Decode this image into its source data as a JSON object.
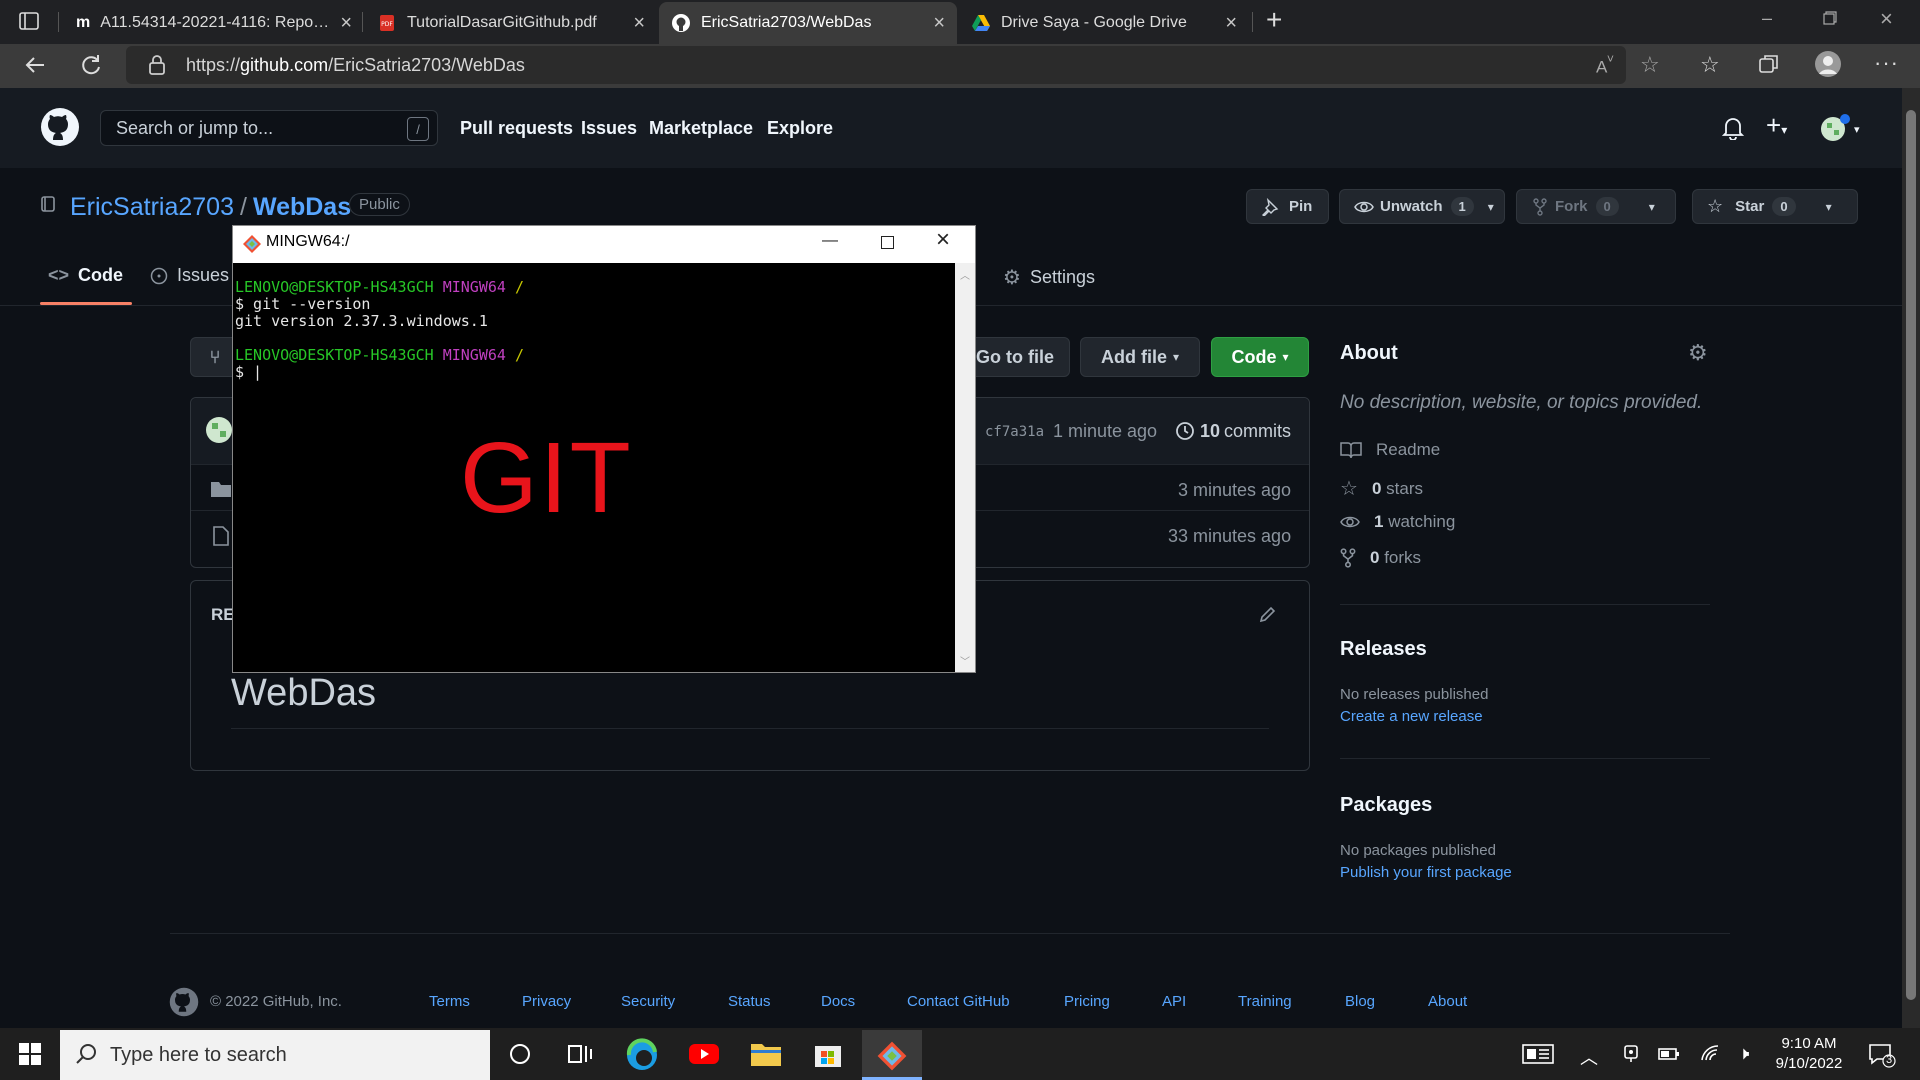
{
  "browser": {
    "tabs": [
      {
        "label": "A11.54314-20221-4116: Repositc"
      },
      {
        "label": "TutorialDasarGitGithub.pdf"
      },
      {
        "label": "EricSatria2703/WebDas"
      },
      {
        "label": "Drive Saya - Google Drive"
      }
    ],
    "url_prefix": "https://",
    "url_host": "github.com",
    "url_path": "/EricSatria2703/WebDas"
  },
  "github": {
    "search_placeholder": "Search or jump to...",
    "search_key": "/",
    "nav": [
      "Pull requests",
      "Issues",
      "Marketplace",
      "Explore"
    ]
  },
  "repo": {
    "owner": "EricSatria2703",
    "sep": "/",
    "name": "WebDas",
    "visibility": "Public",
    "pin_label": "Pin",
    "watch_label": "Unwatch",
    "watch_count": "1",
    "fork_label": "Fork",
    "fork_count": "0",
    "star_label": "Star",
    "star_count": "0",
    "tabs": {
      "code": "Code",
      "issues": "Issues",
      "settings": "Settings"
    },
    "goto_file": "Go to file",
    "add_file": "Add file",
    "code_btn": "Code",
    "commit_hash": "cf7a31a",
    "commit_time": "1 minute ago",
    "commits_count": "10",
    "commits_label": "commits",
    "rows": [
      {
        "time": "3 minutes ago"
      },
      {
        "time": "33 minutes ago"
      }
    ],
    "readme_label_partial": "RE",
    "readme_title": "WebDas"
  },
  "about": {
    "title": "About",
    "description": "No description, website, or topics provided.",
    "readme": "Readme",
    "stars_count": "0",
    "stars_label": "stars",
    "watching_count": "1",
    "watching_label": "watching",
    "forks_count": "0",
    "forks_label": "forks",
    "releases_title": "Releases",
    "releases_none": "No releases published",
    "releases_link": "Create a new release",
    "packages_title": "Packages",
    "packages_none": "No packages published",
    "packages_link": "Publish your first package"
  },
  "footer": {
    "copyright": "© 2022 GitHub, Inc.",
    "links": [
      "Terms",
      "Privacy",
      "Security",
      "Status",
      "Docs",
      "Contact GitHub",
      "Pricing",
      "API",
      "Training",
      "Blog",
      "About"
    ]
  },
  "terminal": {
    "title": "MINGW64:/",
    "prompt_user": "LENOVO@DESKTOP-HS43GCH",
    "prompt_env": "MINGW64",
    "prompt_dir": "/",
    "cmd1": "$ git --version",
    "out1": "git version 2.37.3.windows.1",
    "cmd2": "$ |",
    "overlay": "GIT",
    "overlay_color": "#e8141b"
  },
  "taskbar": {
    "search_placeholder": "Type here to search",
    "time": "9:10 AM",
    "date": "9/10/2022",
    "notifications": "3"
  },
  "colors": {
    "accent": "#58a6ff",
    "green_button": "#238636",
    "bg": "#0d1117"
  }
}
